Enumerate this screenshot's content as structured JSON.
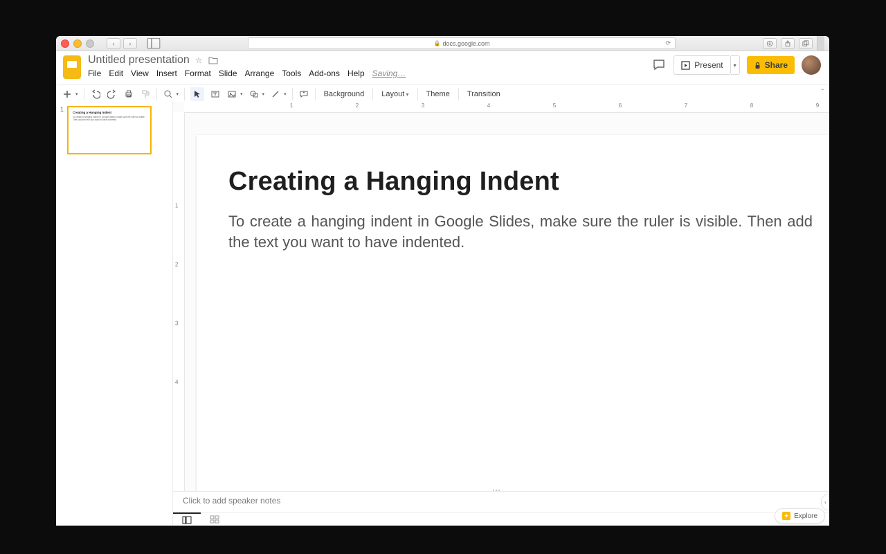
{
  "browser": {
    "url": "docs.google.com"
  },
  "doc": {
    "title": "Untitled presentation",
    "menus": [
      "File",
      "Edit",
      "View",
      "Insert",
      "Format",
      "Slide",
      "Arrange",
      "Tools",
      "Add-ons",
      "Help"
    ],
    "status": "Saving…",
    "present_label": "Present",
    "share_label": "Share"
  },
  "toolbar": {
    "background": "Background",
    "layout": "Layout",
    "theme": "Theme",
    "transition": "Transition"
  },
  "ruler": {
    "h": [
      "",
      "1",
      "2",
      "3",
      "4",
      "5",
      "6",
      "7",
      "8",
      "9"
    ],
    "v": [
      "",
      "1",
      "2",
      "3",
      "4"
    ]
  },
  "slide": {
    "title": "Creating a Hanging Indent",
    "body": "To create a hanging indent in Google Slides, make sure the ruler is visible. Then add the text you want to have indented."
  },
  "filmstrip": {
    "slides": [
      {
        "n": "1",
        "title": "Creating a Hanging Indent",
        "body": "To create a hanging indent in Google Slides, make sure the ruler is visible. Then add the text you want to have indented."
      }
    ]
  },
  "notes": {
    "placeholder": "Click to add speaker notes"
  },
  "explore": {
    "label": "Explore"
  }
}
